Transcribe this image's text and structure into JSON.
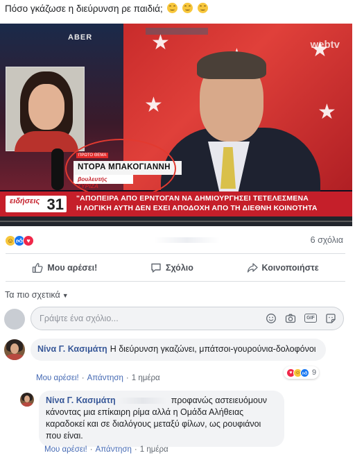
{
  "post": {
    "text": "Πόσο γκάζωσε η διεύρυνση ρε παιδιά;"
  },
  "video": {
    "studio_label": "ABER",
    "watermark": "webtv",
    "nameplate_top": "ΠΡΩΤΟ ΘΕΜΑ",
    "nameplate_name": "ΝΤΟΡΑ ΜΠΑΚΟΓΙΑΝΝΗ",
    "nameplate_role": "βουλευτής ΣΥΡΙΖΑ",
    "ticker_line1": "\"ΑΠΟΠΕΙΡΑ ΑΠΟ  ΕΡΝΤΟΓΑΝ ΝΑ ΔΗΜΙΟΥΡΓΗΣΕΙ ΤΕΤΕΛΕΣΜΕΝΑ",
    "ticker_line2": "Η ΛΟΓΙΚΗ ΑΥΤΗ ΔΕΝ ΕΧΕΙ ΑΠΟΔΟΧΗ ΑΠΟ ΤΗ ΔΙΕΘΝΗ ΚΟΙΝΟΤΗΤΑ",
    "channel_logo": "ειδήσεις",
    "channel_number": "31",
    "progress_fraction": 0.0
  },
  "reactions_summary": {
    "comments_count": "6 σχόλια"
  },
  "actions": {
    "like": "Μου αρέσει!",
    "comment": "Σχόλιο",
    "share": "Κοινοποιήστε"
  },
  "sort": {
    "label": "Τα πιο σχετικά"
  },
  "composer": {
    "placeholder": "Γράψτε ένα σχόλιο..."
  },
  "comments": [
    {
      "author": "Νίνα Γ. Κασιμάτη",
      "text": "Η διεύρυνση γκαζώνει, μπάτσοι-γουρούνια-δολοφόνοι",
      "like": "Μου αρέσει!",
      "reply": "Απάντηση",
      "time": "1 ημέρα",
      "reaction_count": "9"
    },
    {
      "author": "Νίνα Γ. Κασιμάτη",
      "text": "προφανώς αστειευόμουν κάνοντας μια επίκαιρη ρίμα αλλά η Ομάδα Αλήθειας καραδοκεί και σε διαλόγους μεταξύ φίλων, ως ρουφιάνοι που είναι.",
      "like": "Μου αρέσει!",
      "reply": "Απάντηση",
      "time": "1 ημέρα"
    }
  ],
  "colors": {
    "link_blue": "#385898",
    "facebook_blue": "#1877f2",
    "ticker_red": "#c51f2a",
    "love_red": "#f0284a"
  }
}
